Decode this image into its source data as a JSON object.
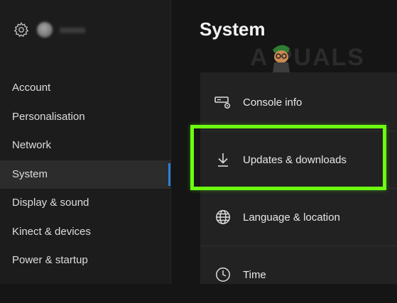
{
  "header": {
    "title": "System"
  },
  "watermark": {
    "text": "A  PUALS"
  },
  "profile": {
    "gamertag": "xxxxxx"
  },
  "sidebar": {
    "items": [
      {
        "label": "Account"
      },
      {
        "label": "Personalisation"
      },
      {
        "label": "Network"
      },
      {
        "label": "System",
        "selected": true
      },
      {
        "label": "Display & sound"
      },
      {
        "label": "Kinect & devices"
      },
      {
        "label": "Power & startup"
      }
    ]
  },
  "options": [
    {
      "label": "Console info",
      "icon": "console-info-icon"
    },
    {
      "label": "Updates & downloads",
      "icon": "download-arrow-icon",
      "highlighted": true
    },
    {
      "label": "Language & location",
      "icon": "globe-icon"
    },
    {
      "label": "Time",
      "icon": "clock-icon"
    }
  ],
  "colors": {
    "accent": "#2a82d6",
    "highlight": "#6cff10",
    "background": "#151515",
    "panel": "#222222"
  }
}
